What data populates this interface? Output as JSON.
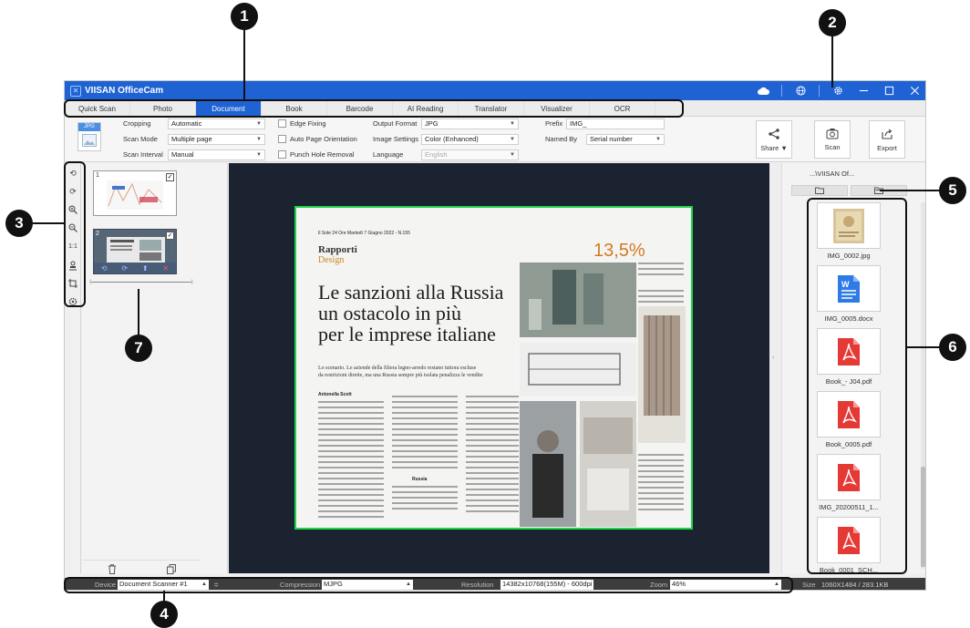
{
  "app": {
    "title": "VIISAN OfficeCam"
  },
  "callouts": [
    "1",
    "2",
    "3",
    "4",
    "5",
    "6",
    "7"
  ],
  "tabs": [
    "Quick Scan",
    "Photo",
    "Document",
    "Book",
    "Barcode",
    "AI Reading",
    "Translator",
    "Visualizer",
    "OCR"
  ],
  "active_tab": "Document",
  "ribbon": {
    "format_badge": "JPG",
    "cropping_label": "Cropping",
    "cropping_value": "Automatic",
    "scan_mode_label": "Scan Mode",
    "scan_mode_value": "Multiple page",
    "scan_interval_label": "Scan Interval",
    "scan_interval_value": "Manual",
    "edge_fixing": "Edge Fixing",
    "auto_page_orientation": "Auto Page Orientation",
    "punch_hole_removal": "Punch Hole Removal",
    "output_format_label": "Output Format",
    "output_format_value": "JPG",
    "image_settings_label": "Image Settings",
    "image_settings_value": "Color (Enhanced)",
    "language_label": "Language",
    "language_value": "English",
    "prefix_label": "Prefix",
    "prefix_value": "IMG_",
    "named_by_label": "Named By",
    "named_by_value": "Serial number",
    "share_label": "Share ▼",
    "scan_label": "Scan",
    "export_label": "Export"
  },
  "left_tools": [
    "rotate-left-icon",
    "rotate-right-icon",
    "zoom-in-icon",
    "zoom-out-icon",
    "actual-size-icon",
    "stamp-icon",
    "crop-icon",
    "settings-icon"
  ],
  "left_tools_actual_size": "1:1",
  "thumbnails": [
    {
      "num": "1",
      "checked": true
    },
    {
      "num": "2",
      "checked": true
    }
  ],
  "document": {
    "masthead": "Il Sole 24 Ore Martedì 7 Giugno 2022 - N.155",
    "section": "Rapporti",
    "subsection": "Design",
    "percent": "13,5%",
    "headline_1": "Le sanzioni alla Russia",
    "headline_2": "un ostacolo in più",
    "headline_3": "per le imprese italiane",
    "lead": "Lo scenario. Le aziende della filiera legno-arredo restano tuttora escluse",
    "lead_2": "da restrizioni dirette, ma una Russia sempre più isolata penalizza le vendite",
    "byline": "Antonella Scott",
    "subhead": "Russia"
  },
  "files": {
    "path": "...\\VIISAN Of...",
    "items": [
      {
        "name": "IMG_0002.jpg",
        "type": "image"
      },
      {
        "name": "IMG_0005.docx",
        "type": "word"
      },
      {
        "name": "Book_- J04.pdf",
        "type": "pdf"
      },
      {
        "name": "Book_0005.pdf",
        "type": "pdf"
      },
      {
        "name": "IMG_20200511_1...",
        "type": "pdf"
      },
      {
        "name": "Book_0001_SCH...",
        "type": "pdf"
      }
    ]
  },
  "status": {
    "device_label": "Device",
    "device_value": "Document Scanner #1",
    "compression_label": "Compression",
    "compression_value": "MJPG",
    "resolution_label": "Resolution",
    "resolution_value": "14382x10768(155M) - 600dpi",
    "zoom_label": "Zoom",
    "zoom_value": "46%",
    "size_label": "Size",
    "size_value": "1060X1484 / 283.1KB"
  },
  "colors": {
    "accent": "#1e62d4",
    "crop_border": "#1fd34a",
    "pdf": "#e53935",
    "word": "#2f7be5",
    "callout": "#111111"
  }
}
